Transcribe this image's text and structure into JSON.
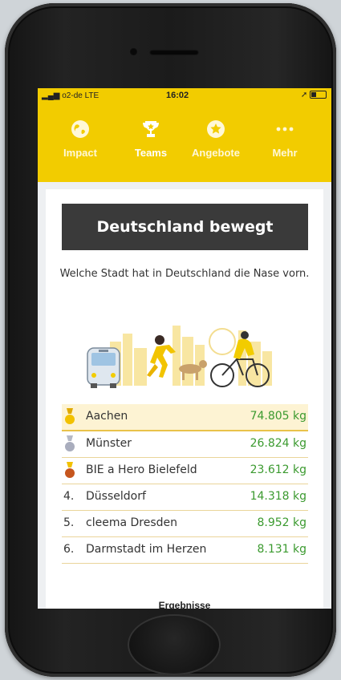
{
  "statusbar": {
    "carrier": "o2-de",
    "network": "LTE",
    "time": "16:02"
  },
  "nav": {
    "items": [
      {
        "label": "Impact",
        "icon": "globe-icon"
      },
      {
        "label": "Teams",
        "icon": "trophy-icon"
      },
      {
        "label": "Angebote",
        "icon": "star-icon"
      },
      {
        "label": "Mehr",
        "icon": "more-dots-icon"
      }
    ]
  },
  "card": {
    "title": "Deutschland bewegt",
    "subtitle": "Welche Stadt hat in Deutschland die Nase vorn."
  },
  "ranking": [
    {
      "rank": "",
      "medal": "gold",
      "name": "Aachen",
      "value": "74.805 kg"
    },
    {
      "rank": "",
      "medal": "silver",
      "name": "Münster",
      "value": "26.824 kg"
    },
    {
      "rank": "",
      "medal": "bronze",
      "name": "BIE a Hero Bielefeld",
      "value": "23.612 kg"
    },
    {
      "rank": "4.",
      "medal": "",
      "name": "Düsseldorf",
      "value": "14.318 kg"
    },
    {
      "rank": "5.",
      "medal": "",
      "name": "cleema Dresden",
      "value": "8.952 kg"
    },
    {
      "rank": "6.",
      "medal": "",
      "name": "Darmstadt im Herzen",
      "value": "8.131 kg"
    }
  ],
  "footer": {
    "label": "Ergebnisse"
  },
  "colors": {
    "accent": "#f2cc00",
    "value_green": "#3b9a2f",
    "title_bg": "#3a3a3a"
  }
}
